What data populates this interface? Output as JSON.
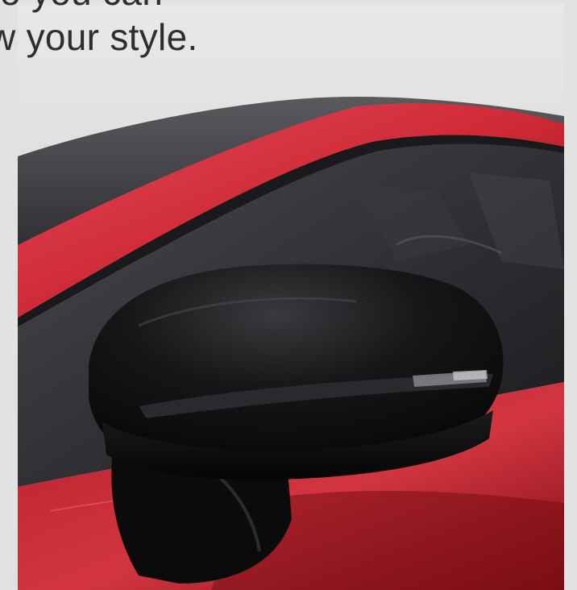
{
  "headline": {
    "line1": "o you can",
    "line2": "w your style."
  },
  "image": {
    "subject": "red car side mirror",
    "colors": {
      "car_red": "#d4303b",
      "mirror_black": "#121214",
      "background_gray": "#e2e2e2"
    }
  }
}
